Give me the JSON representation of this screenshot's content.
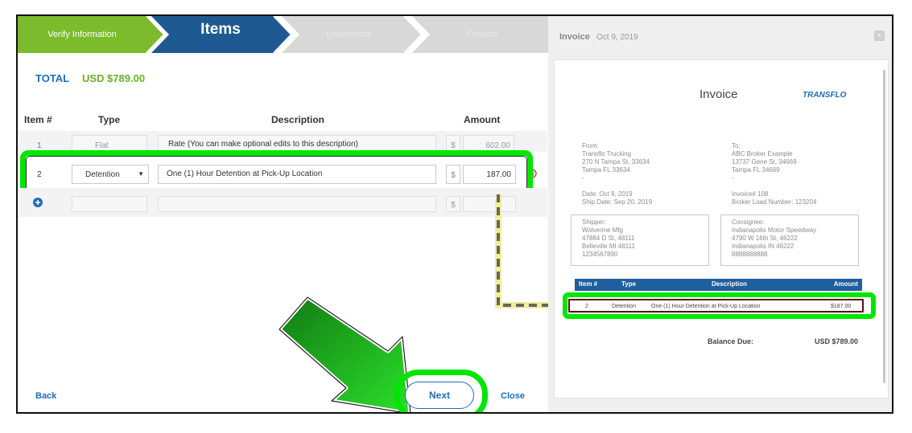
{
  "steps": [
    {
      "label": "Verify Information",
      "state": "done"
    },
    {
      "label": "Items",
      "state": "active"
    },
    {
      "label": "Documents",
      "state": "upcoming"
    },
    {
      "label": "Finalize",
      "state": "upcoming"
    }
  ],
  "total": {
    "label": "TOTAL",
    "value": "USD $789.00"
  },
  "table": {
    "headers": {
      "item": "Item #",
      "type": "Type",
      "description": "Description",
      "amount": "Amount"
    },
    "rows": [
      {
        "item": "1",
        "type": "Flat",
        "description": "Rate (You can make optional edits to this description)",
        "currency": "$",
        "amount": "602.00"
      },
      {
        "item": "2",
        "type": "Detention",
        "description": "One (1) Hour Detention at Pick-Up Location",
        "currency": "$",
        "amount": "187.00"
      }
    ],
    "new_row_currency": "$"
  },
  "footer": {
    "back": "Back",
    "next": "Next",
    "close": "Close"
  },
  "preview": {
    "header_title": "Invoice",
    "header_date": "Oct 9, 2019",
    "close_glyph": "×",
    "doc_title": "Invoice",
    "logo": "TRANSFLO",
    "from": "From:\nTransflo Trucking\n270 N Tampa St, 33634\nTampa FL 33634\n-",
    "to": "To:\nABC Broker Example\n13737 Gene St, 34669\nTampa FL 34669\n-",
    "dates": "Date: Oct 9, 2019\nShip Date: Sep 20, 2019",
    "invoice_info": "Invoice# 108\nBroker Load Number: 123204",
    "shipper": "Shipper:\nWolverine Mfg\n47884 D St, 48111\nBelleville MI 48111\n1234567890",
    "consignee": "Consignee:\nIndianapolis Motor Speedway\n4790 W 16th St, 46222\nIndianapolis IN 46222\n8888888888",
    "items_header": {
      "item": "Item #",
      "type": "Type",
      "description": "Description",
      "amount": "Amount"
    },
    "item_row": {
      "item": "2",
      "type": "Detention",
      "description": "One (1) Hour Detention at Pick-Up Location",
      "amount": "$187.00"
    },
    "balance_label": "Balance Due:",
    "balance_value": "USD $789.00"
  },
  "colors": {
    "green_highlight": "#00e600",
    "step_done": "#7cbb2c",
    "step_active": "#1e5a91",
    "step_upcoming": "#d8d8d8",
    "accent_blue": "#1e6db5",
    "total_green": "#6ab023"
  }
}
